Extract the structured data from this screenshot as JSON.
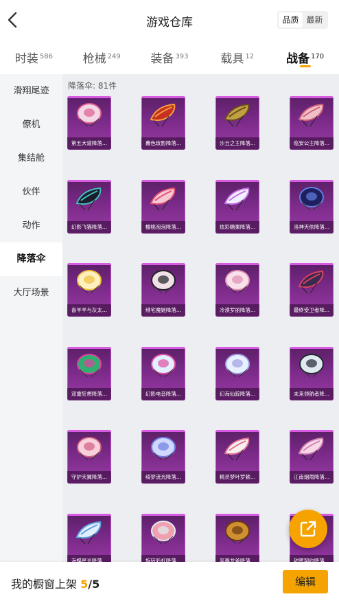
{
  "header": {
    "title": "游戏仓库",
    "sort_options": [
      "品质",
      "最新"
    ],
    "sort_selected": "品质"
  },
  "tabs": [
    {
      "label": "时装",
      "count": "586"
    },
    {
      "label": "枪械",
      "count": "249"
    },
    {
      "label": "装备",
      "count": "393"
    },
    {
      "label": "载具",
      "count": "12"
    },
    {
      "label": "战备",
      "count": "170",
      "active": true
    }
  ],
  "sidebar": {
    "items": [
      {
        "label": "滑翔尾迹"
      },
      {
        "label": "僚机"
      },
      {
        "label": "集结舱"
      },
      {
        "label": "伙伴"
      },
      {
        "label": "动作"
      },
      {
        "label": "降落伞",
        "active": true
      },
      {
        "label": "大厅场景"
      }
    ]
  },
  "content": {
    "count_text": "降落伞: 81件",
    "items": [
      {
        "name": "第五大道降落...",
        "shape": "round",
        "colors": [
          "#f2d8e6",
          "#e06090"
        ]
      },
      {
        "name": "暮色玫影降落...",
        "shape": "wing",
        "colors": [
          "#c83020",
          "#f0a040"
        ]
      },
      {
        "name": "沙丘之主降落...",
        "shape": "wing",
        "colors": [
          "#c0a040",
          "#6a4a20"
        ]
      },
      {
        "name": "临安公主降落...",
        "shape": "wing",
        "colors": [
          "#f0c0c8",
          "#d0607a"
        ]
      },
      {
        "name": "幻影飞猫降落...",
        "shape": "wing",
        "colors": [
          "#1c1c2a",
          "#40c0c0"
        ]
      },
      {
        "name": "樱桃泡泡降落...",
        "shape": "wing",
        "colors": [
          "#f6c8d6",
          "#e05070"
        ]
      },
      {
        "name": "炫彩糖果降落...",
        "shape": "wing",
        "colors": [
          "#f0f0ff",
          "#c070e0"
        ]
      },
      {
        "name": "洛神天依降落...",
        "shape": "round",
        "colors": [
          "#202060",
          "#6080e0"
        ]
      },
      {
        "name": "喜羊羊与灰太...",
        "shape": "round",
        "colors": [
          "#fff0c0",
          "#f0c040"
        ]
      },
      {
        "name": "绯宅魔姬降落...",
        "shape": "round",
        "colors": [
          "#f0e0e8",
          "#202020"
        ]
      },
      {
        "name": "冷漠罗丽降落...",
        "shape": "round",
        "colors": [
          "#f8e0ec",
          "#e090b0"
        ]
      },
      {
        "name": "最终受卫者降...",
        "shape": "wing",
        "colors": [
          "#3a2a50",
          "#e04060"
        ]
      },
      {
        "name": "双重狂想降落...",
        "shape": "round",
        "colors": [
          "#30b070",
          "#e040a0"
        ]
      },
      {
        "name": "幻影电音降落...",
        "shape": "round",
        "colors": [
          "#e0f0ff",
          "#e050a0"
        ]
      },
      {
        "name": "幻海仙踪降落...",
        "shape": "round",
        "colors": [
          "#e8f0ff",
          "#a0a0e0"
        ]
      },
      {
        "name": "未来领航者降...",
        "shape": "round",
        "colors": [
          "#e0e8f0",
          "#202830"
        ]
      },
      {
        "name": "守护天翼降落...",
        "shape": "round",
        "colors": [
          "#f8d0dc",
          "#d06080"
        ]
      },
      {
        "name": "绮梦流光降落...",
        "shape": "round",
        "colors": [
          "#d0d8ff",
          "#7080e0"
        ]
      },
      {
        "name": "精灵梦叶罗顿...",
        "shape": "wing",
        "colors": [
          "#f8f0f0",
          "#e07090"
        ]
      },
      {
        "name": "江南烟雨降落...",
        "shape": "wing",
        "colors": [
          "#f8d8e8",
          "#d080b0"
        ]
      },
      {
        "name": "海蝶星光降落...",
        "shape": "wing",
        "colors": [
          "#e0f0ff",
          "#60a0e0"
        ]
      },
      {
        "name": "旋转彩虹降落...",
        "shape": "round",
        "colors": [
          "#f0a0b0",
          "#e0f0f0"
        ]
      },
      {
        "name": "至尊龙爸降落...",
        "shape": "round",
        "colors": [
          "#d09030",
          "#6a3a10"
        ]
      },
      {
        "name": "甜蜜契约降落...",
        "shape": "round",
        "colors": [
          "#f8d8e0",
          "#e06080"
        ]
      }
    ]
  },
  "footer": {
    "label": "我的橱窗上架",
    "current": "5",
    "total": "/5",
    "edit_label": "编辑"
  },
  "colors": {
    "accent": "#f5a300",
    "card_top": "#5b1f66",
    "card_bottom": "#9a3aa6"
  },
  "icons": {
    "back": "chevron-left-icon",
    "share": "share-external-icon"
  }
}
